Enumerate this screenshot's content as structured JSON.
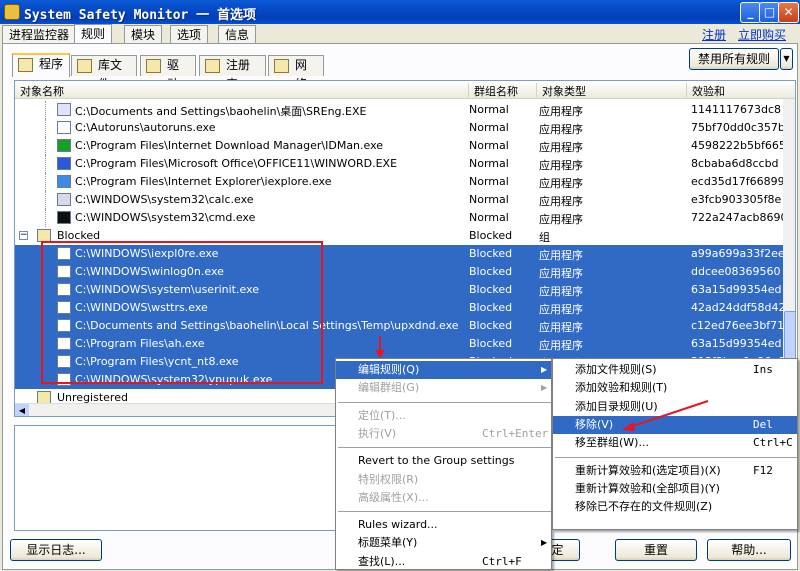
{
  "window": {
    "title": "System Safety Monitor 一 首选项"
  },
  "top_tabs": [
    "进程监控器",
    "规则",
    "模块",
    "选项",
    "信息"
  ],
  "top_links": {
    "register": "注册",
    "buy": "立即购买"
  },
  "sub_tabs": [
    "程序",
    "库文件",
    "驱动",
    "注册表",
    "网络"
  ],
  "buttons": {
    "disable_all": "禁用所有规则",
    "show_log": "显示日志...",
    "ok": "定",
    "reset": "重置",
    "help": "帮助..."
  },
  "columns": [
    "对象名称",
    "群组名称",
    "对象类型",
    "效验和"
  ],
  "rows": [
    {
      "path": "C:\\Documents and Settings\\baohelin\\桌面\\SREng.EXE",
      "group": "Normal",
      "type": "应用程序",
      "hash": "1141117673dc8",
      "icon": "exe-icon"
    },
    {
      "path": "C:\\Autoruns\\autoruns.exe",
      "group": "Normal",
      "type": "应用程序",
      "hash": "75bf70dd0c357b",
      "icon": "autoruns-icon"
    },
    {
      "path": "C:\\Program Files\\Internet Download Manager\\IDMan.exe",
      "group": "Normal",
      "type": "应用程序",
      "hash": "4598222b5bf665",
      "icon": "idm-icon"
    },
    {
      "path": "C:\\Program Files\\Microsoft Office\\OFFICE11\\WINWORD.EXE",
      "group": "Normal",
      "type": "应用程序",
      "hash": "8cbaba6d8ccbd",
      "icon": "word-icon"
    },
    {
      "path": "C:\\Program Files\\Internet Explorer\\iexplore.exe",
      "group": "Normal",
      "type": "应用程序",
      "hash": "ecd35d17f66899",
      "icon": "ie-icon"
    },
    {
      "path": "C:\\WINDOWS\\system32\\calc.exe",
      "group": "Normal",
      "type": "应用程序",
      "hash": "e3fcb903305f8e",
      "icon": "calc-icon"
    },
    {
      "path": "C:\\WINDOWS\\system32\\cmd.exe",
      "group": "Normal",
      "type": "应用程序",
      "hash": "722a247acb8690",
      "icon": "cmd-icon"
    }
  ],
  "blocked_group": {
    "name": "Blocked",
    "group": "Blocked",
    "type": "组"
  },
  "blocked_rows": [
    {
      "path": "C:\\WINDOWS\\iexpl0re.exe",
      "group": "Blocked",
      "type": "应用程序",
      "hash": "a99a699a33f2ee"
    },
    {
      "path": "C:\\WINDOWS\\winlog0n.exe",
      "group": "Blocked",
      "type": "应用程序",
      "hash": "ddcee08369560"
    },
    {
      "path": "C:\\WINDOWS\\system\\userinit.exe",
      "group": "Blocked",
      "type": "应用程序",
      "hash": "63a15d99354ed"
    },
    {
      "path": "C:\\WINDOWS\\wsttrs.exe",
      "group": "Blocked",
      "type": "应用程序",
      "hash": "42ad24ddf58d42"
    },
    {
      "path": "C:\\Documents and Settings\\baohelin\\Local Settings\\Temp\\upxdnd.exe",
      "group": "Blocked",
      "type": "应用程序",
      "hash": "c12ed76ee3bf71"
    },
    {
      "path": "C:\\Program Files\\ah.exe",
      "group": "Blocked",
      "type": "应用程序",
      "hash": "63a15d99354ed"
    },
    {
      "path": "C:\\Program Files\\ycnt_nt8.exe",
      "group": "Blocked",
      "type": "应用程序",
      "hash": "313f3baa1a86e0"
    },
    {
      "path": "C:\\WINDOWS\\system32\\ypupuk.exe",
      "group": "Blocked",
      "type": "应用程序",
      "hash": ""
    }
  ],
  "unregistered": "Unregistered",
  "context_menu": [
    {
      "label": "编辑规则(Q)",
      "key": "",
      "submenu": true,
      "state": "highlight"
    },
    {
      "label": "编辑群组(G)",
      "key": "",
      "submenu": true,
      "state": "disabled"
    },
    {
      "sep": true
    },
    {
      "label": "定位(T)...",
      "key": "",
      "state": "disabled"
    },
    {
      "label": "执行(V)",
      "key": "Ctrl+Enter",
      "state": "disabled"
    },
    {
      "sep": true
    },
    {
      "label": "Revert to the Group settings",
      "key": "",
      "state": "normal"
    },
    {
      "label": "特别权限(R)",
      "key": "",
      "state": "disabled"
    },
    {
      "label": "高级属性(X)...",
      "key": "",
      "state": "disabled"
    },
    {
      "sep": true
    },
    {
      "label": "Rules wizard...",
      "key": "",
      "state": "normal"
    },
    {
      "label": "标题菜单(Y)",
      "key": "",
      "submenu": true,
      "state": "normal"
    },
    {
      "label": "查找(L)...",
      "key": "Ctrl+F",
      "state": "normal"
    }
  ],
  "submenu": [
    {
      "label": "添加文件规则(S)",
      "key": "Ins",
      "state": "normal"
    },
    {
      "label": "添加效验和规则(T)",
      "key": "",
      "state": "normal"
    },
    {
      "label": "添加目录规则(U)",
      "key": "",
      "state": "normal"
    },
    {
      "label": "移除(V)",
      "key": "Del",
      "state": "highlight"
    },
    {
      "label": "移至群组(W)...",
      "key": "Ctrl+C",
      "state": "normal"
    },
    {
      "sep": true
    },
    {
      "label": "重新计算效验和(选定项目)(X)",
      "key": "F12",
      "state": "normal"
    },
    {
      "label": "重新计算效验和(全部项目)(Y)",
      "key": "",
      "state": "normal"
    },
    {
      "label": "移除已不存在的文件规则(Z)",
      "key": "",
      "state": "normal"
    }
  ]
}
